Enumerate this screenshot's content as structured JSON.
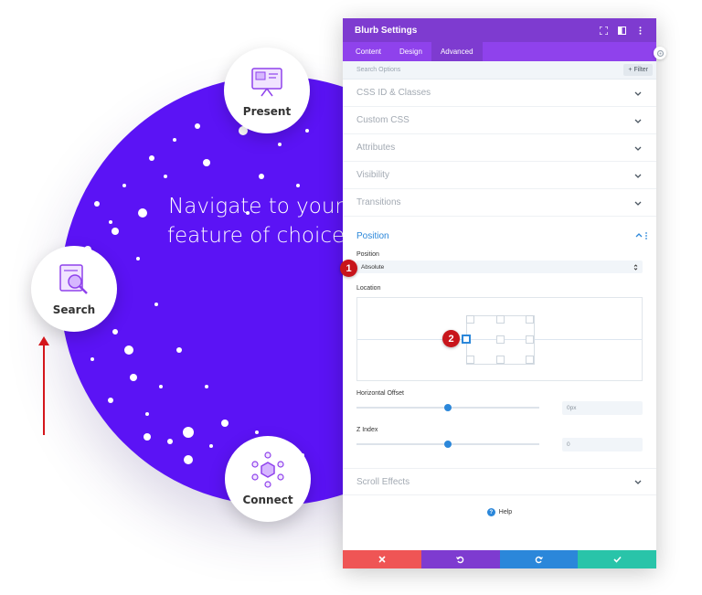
{
  "background": {
    "headline_line1": "Navigate to your",
    "headline_line2": "feature of choice",
    "circle_color": "#5b13f5",
    "bubbles": [
      {
        "label": "Present",
        "icon": "presentation-icon"
      },
      {
        "label": "Search",
        "icon": "search-icon"
      },
      {
        "label": "Connect",
        "icon": "network-icon"
      }
    ]
  },
  "panel": {
    "title": "Blurb Settings",
    "header_icons": [
      "fullscreen-icon",
      "split-view-icon",
      "more-options-icon"
    ],
    "tabs": [
      {
        "label": "Content",
        "active": false
      },
      {
        "label": "Design",
        "active": false
      },
      {
        "label": "Advanced",
        "active": true
      }
    ],
    "search_placeholder": "Search Options",
    "filter_label": "Filter",
    "sections": [
      {
        "title": "CSS ID & Classes"
      },
      {
        "title": "Custom CSS"
      },
      {
        "title": "Attributes"
      },
      {
        "title": "Visibility"
      },
      {
        "title": "Transitions"
      }
    ],
    "position_section": {
      "title": "Position",
      "position_label": "Position",
      "position_value": "Absolute",
      "location_label": "Location",
      "horizontal_offset_label": "Horizontal Offset",
      "horizontal_offset_value": "0px",
      "z_index_label": "Z Index",
      "z_index_value": "0"
    },
    "scroll_effects_title": "Scroll Effects",
    "help_label": "Help",
    "footer_colors": {
      "cancel": "#ef5555",
      "undo": "#7e3bd0",
      "redo": "#2b87da",
      "save": "#29c4a9"
    },
    "accent": "#2b87da"
  },
  "annotations": {
    "badge1": "1",
    "badge2": "2"
  }
}
